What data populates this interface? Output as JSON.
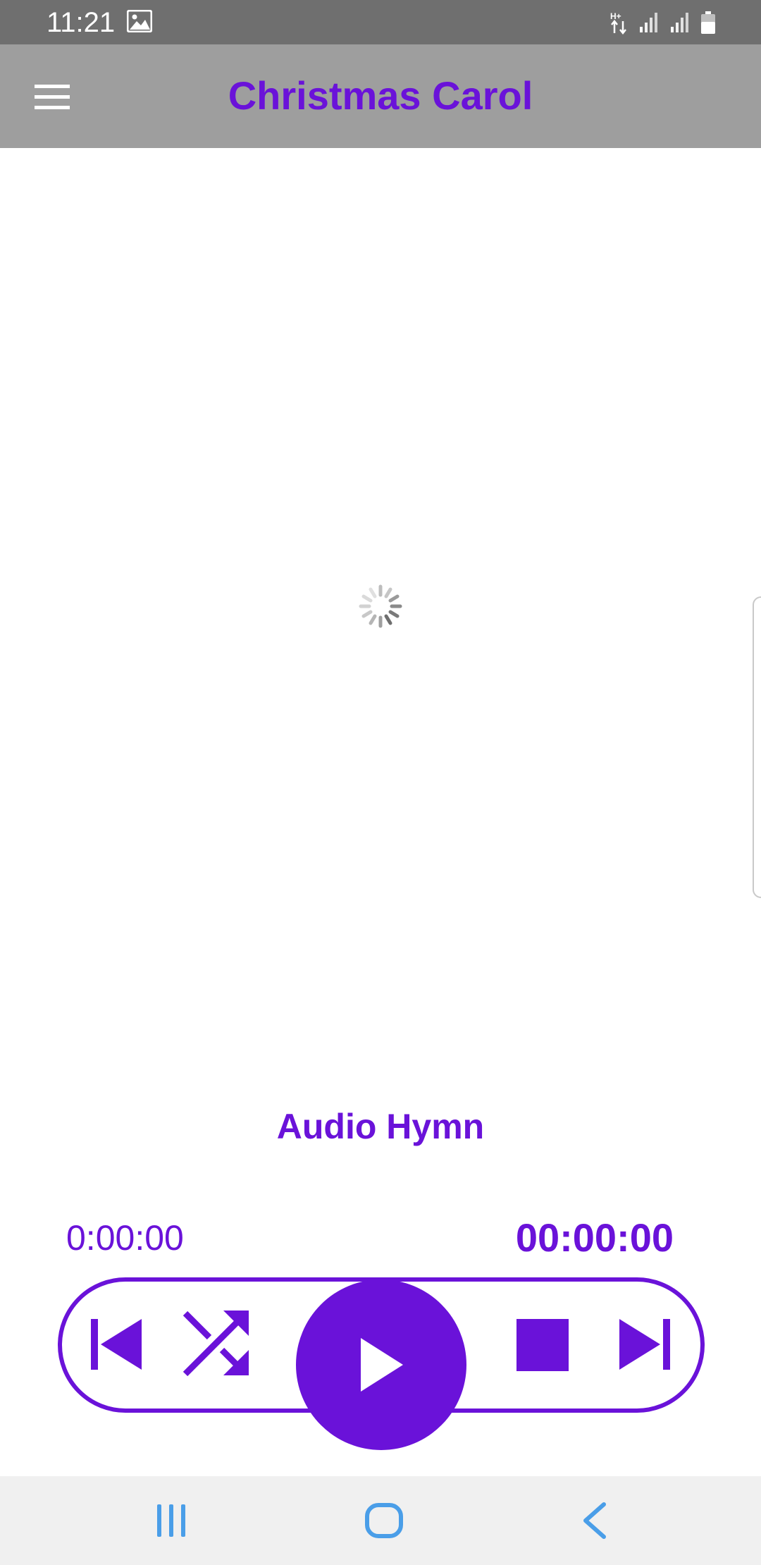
{
  "status_bar": {
    "time": "11:21",
    "icons": [
      "image-icon",
      "data-transfer-icon",
      "signal-icon",
      "signal-icon",
      "battery-icon"
    ]
  },
  "app_bar": {
    "title": "Christmas Carol",
    "menu_icon": "hamburger-menu-icon"
  },
  "content": {
    "loading_indicator": "spinner-icon"
  },
  "player": {
    "track_title": "Audio Hymn",
    "elapsed_time": "0:00:00",
    "total_time": "00:00:00",
    "controls": {
      "previous_icon": "skip-previous-icon",
      "shuffle_icon": "shuffle-icon",
      "play_icon": "play-icon",
      "stop_icon": "stop-icon",
      "next_icon": "skip-next-icon"
    }
  },
  "nav_bar": {
    "buttons": [
      "recents-icon",
      "home-icon",
      "back-icon"
    ]
  },
  "colors": {
    "accent": "#6a12d9",
    "app_bar_bg": "#9e9e9e",
    "status_bar_bg": "#6f6f6f",
    "nav_bar_bg": "#f0f0f0",
    "nav_icon": "#4a9ee8"
  }
}
